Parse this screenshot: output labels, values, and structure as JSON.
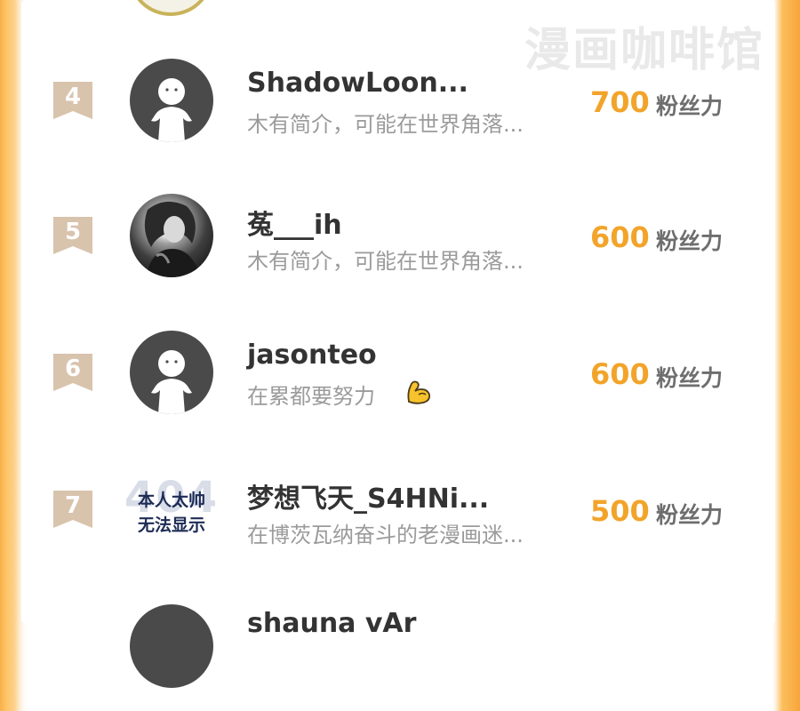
{
  "watermark": "漫画咖啡馆",
  "colors": {
    "score": "#f2a42a",
    "rank_badge": "#d8c3ad",
    "name": "#333333",
    "bio": "#9b9b9b",
    "side_gradient": "#f8a53a"
  },
  "unit_label": "粉丝力",
  "rows": [
    {
      "rank": "4",
      "avatar": "default-avatar",
      "name": "ShadowLoon...",
      "bio": "木有简介，可能在世界角落...",
      "score": "700"
    },
    {
      "rank": "5",
      "avatar": "photo-avatar",
      "name": "菟___ih",
      "bio": "木有简介，可能在世界角落...",
      "score": "600"
    },
    {
      "rank": "6",
      "avatar": "default-avatar",
      "name": "jasonteo",
      "bio": "在累都要努力",
      "bio_icon": "flexed-biceps-icon",
      "score": "600"
    },
    {
      "rank": "7",
      "avatar": "text-avatar",
      "avatar_text": [
        "本人太帅",
        "无法显示"
      ],
      "avatar_bg_text": "404",
      "name": "梦想飞天_S4HNi...",
      "bio": "在博茨瓦纳奋斗的老漫画迷...",
      "score": "500"
    },
    {
      "name_partial": "shauna vAr"
    }
  ]
}
